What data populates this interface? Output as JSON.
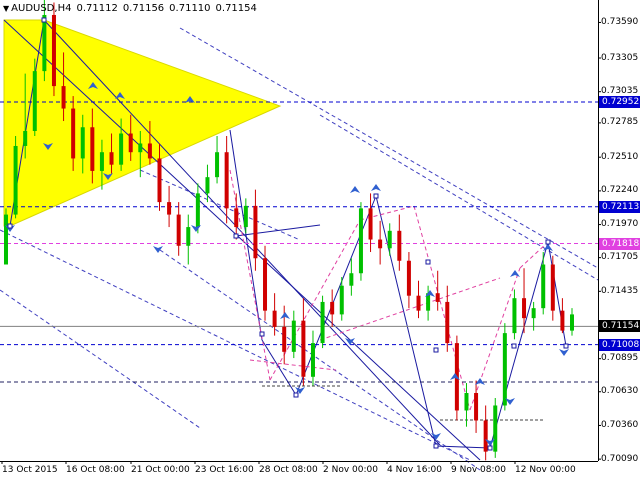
{
  "header": {
    "symbol": "AUDUSD,H4",
    "open": "0.71112",
    "high": "0.71156",
    "low": "0.71110",
    "close": "0.71154"
  },
  "colors": {
    "bull": "#00c000",
    "bear": "#d00000",
    "wedge": "#ffff00",
    "trend_line": "#1a1aa0",
    "channel": "#4040c0",
    "magenta": "#e040a0",
    "price_tag_blue": "#0000d0",
    "price_tag_magenta": "#e040e0",
    "current_tag": "#000000",
    "arrow": "#3060d0"
  },
  "chart_data": {
    "type": "candlestick",
    "symbol": "AUDUSD,H4",
    "ylim": [
      0.70075,
      0.7377
    ],
    "y_ticks": [
      "0.73590",
      "0.73305",
      "0.73035",
      "0.72785",
      "0.72510",
      "0.72240",
      "0.71970",
      "0.71705",
      "0.71435",
      "0.70895",
      "0.70630",
      "0.70360",
      "0.70090"
    ],
    "x_labels": [
      "13 Oct 2015",
      "16 Oct 08:00",
      "21 Oct 00:00",
      "23 Oct 16:00",
      "28 Oct 08:00",
      "2 Nov 00:00",
      "4 Nov 16:00",
      "9 Nov 08:00",
      "12 Nov 00:00"
    ],
    "levels": [
      {
        "value": 0.72952,
        "label": "0.72952",
        "color": "#0000d0"
      },
      {
        "value": 0.72113,
        "label": "0.72113",
        "color": "#0000d0"
      },
      {
        "value": 0.71818,
        "label": "0.71818",
        "color": "#e040e0"
      },
      {
        "value": 0.71154,
        "label": "0.71154",
        "color": "#000000"
      },
      {
        "value": 0.71008,
        "label": "0.71008",
        "color": "#0000d0"
      }
    ],
    "candles": [
      [
        0.7165,
        0.721,
        0.7195,
        0.7205
      ],
      [
        0.7205,
        0.7268,
        0.7202,
        0.726
      ],
      [
        0.726,
        0.7318,
        0.725,
        0.7272
      ],
      [
        0.7272,
        0.733,
        0.7268,
        0.732
      ],
      [
        0.732,
        0.738,
        0.7312,
        0.7365
      ],
      [
        0.7365,
        0.7375,
        0.73,
        0.7308
      ],
      [
        0.7308,
        0.7335,
        0.728,
        0.729
      ],
      [
        0.729,
        0.73,
        0.724,
        0.725
      ],
      [
        0.725,
        0.7285,
        0.7238,
        0.7275
      ],
      [
        0.7275,
        0.729,
        0.723,
        0.724
      ],
      [
        0.724,
        0.7265,
        0.7225,
        0.7255
      ],
      [
        0.7255,
        0.727,
        0.7238,
        0.7245
      ],
      [
        0.7245,
        0.7282,
        0.724,
        0.727
      ],
      [
        0.727,
        0.7285,
        0.7248,
        0.7255
      ],
      [
        0.7255,
        0.7272,
        0.7235,
        0.7262
      ],
      [
        0.7262,
        0.728,
        0.7245,
        0.725
      ],
      [
        0.725,
        0.7262,
        0.7208,
        0.7215
      ],
      [
        0.7215,
        0.7228,
        0.7195,
        0.7205
      ],
      [
        0.7205,
        0.7215,
        0.7172,
        0.718
      ],
      [
        0.718,
        0.7205,
        0.7165,
        0.7195
      ],
      [
        0.7195,
        0.723,
        0.719,
        0.7222
      ],
      [
        0.7222,
        0.7245,
        0.7215,
        0.7235
      ],
      [
        0.7235,
        0.7268,
        0.723,
        0.7255
      ],
      [
        0.7255,
        0.7268,
        0.7198,
        0.721
      ],
      [
        0.721,
        0.7222,
        0.7185,
        0.7195
      ],
      [
        0.7195,
        0.7218,
        0.719,
        0.7212
      ],
      [
        0.7212,
        0.7225,
        0.716,
        0.717
      ],
      [
        0.717,
        0.718,
        0.712,
        0.7128
      ],
      [
        0.7128,
        0.7142,
        0.7108,
        0.7115
      ],
      [
        0.7115,
        0.7132,
        0.7085,
        0.7095
      ],
      [
        0.7095,
        0.7128,
        0.709,
        0.712
      ],
      [
        0.712,
        0.7138,
        0.7068,
        0.7075
      ],
      [
        0.7075,
        0.7112,
        0.7068,
        0.7102
      ],
      [
        0.7102,
        0.714,
        0.7098,
        0.7135
      ],
      [
        0.7135,
        0.7145,
        0.7115,
        0.7125
      ],
      [
        0.7125,
        0.7155,
        0.712,
        0.7148
      ],
      [
        0.7148,
        0.717,
        0.714,
        0.7158
      ],
      [
        0.7158,
        0.7215,
        0.7152,
        0.721
      ],
      [
        0.721,
        0.7222,
        0.7175,
        0.7185
      ],
      [
        0.7185,
        0.72,
        0.7165,
        0.7178
      ],
      [
        0.7178,
        0.7198,
        0.7172,
        0.7192
      ],
      [
        0.7192,
        0.7205,
        0.716,
        0.7168
      ],
      [
        0.7168,
        0.7175,
        0.713,
        0.714
      ],
      [
        0.714,
        0.7152,
        0.7122,
        0.7128
      ],
      [
        0.7128,
        0.7148,
        0.712,
        0.7142
      ],
      [
        0.7142,
        0.716,
        0.7128,
        0.7135
      ],
      [
        0.7135,
        0.7148,
        0.7095,
        0.7102
      ],
      [
        0.7102,
        0.7108,
        0.704,
        0.7048
      ],
      [
        0.7048,
        0.707,
        0.7035,
        0.7062
      ],
      [
        0.7062,
        0.7072,
        0.703,
        0.704
      ],
      [
        0.704,
        0.7052,
        0.7008,
        0.7015
      ],
      [
        0.7015,
        0.7058,
        0.701,
        0.7052
      ],
      [
        0.7052,
        0.7118,
        0.7048,
        0.711
      ],
      [
        0.711,
        0.7145,
        0.7105,
        0.7138
      ],
      [
        0.7138,
        0.7162,
        0.711,
        0.7122
      ],
      [
        0.7122,
        0.7135,
        0.7112,
        0.713
      ],
      [
        0.713,
        0.7175,
        0.7125,
        0.7165
      ],
      [
        0.7165,
        0.7172,
        0.712,
        0.7128
      ],
      [
        0.7128,
        0.7138,
        0.711,
        0.7112
      ],
      [
        0.7112,
        0.713,
        0.7108,
        0.7125
      ]
    ]
  }
}
